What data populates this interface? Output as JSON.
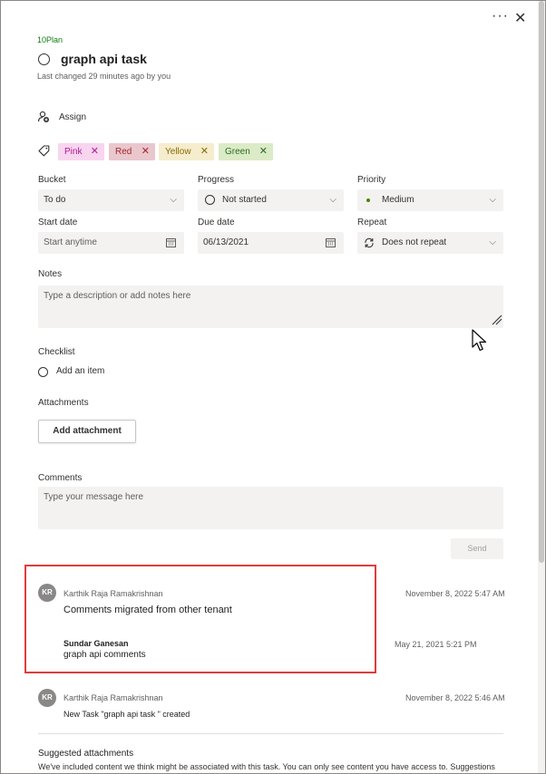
{
  "header": {
    "plan_name": "10Plan",
    "task_title": "graph api task",
    "last_changed": "Last changed 29 minutes ago by you",
    "more_icon": "more-horizontal-icon",
    "close_icon": "close-icon"
  },
  "assign": {
    "label": "Assign"
  },
  "labels": [
    {
      "name": "Pink",
      "bg": "#f8d5ef",
      "color": "#b4178e"
    },
    {
      "name": "Red",
      "bg": "#e9c7cd",
      "color": "#a4262c"
    },
    {
      "name": "Yellow",
      "bg": "#f5edce",
      "color": "#8a6a00"
    },
    {
      "name": "Green",
      "bg": "#dbebc7",
      "color": "#2c6b20"
    }
  ],
  "fields": {
    "bucket": {
      "label": "Bucket",
      "value": "To do"
    },
    "progress": {
      "label": "Progress",
      "value": "Not started"
    },
    "priority": {
      "label": "Priority",
      "value": "Medium",
      "dot_color": "#498205"
    },
    "start_date": {
      "label": "Start date",
      "placeholder": "Start anytime"
    },
    "due_date": {
      "label": "Due date",
      "value": "06/13/2021"
    },
    "repeat": {
      "label": "Repeat",
      "value": "Does not repeat"
    }
  },
  "notes": {
    "label": "Notes",
    "placeholder": "Type a description or add notes here"
  },
  "checklist": {
    "label": "Checklist",
    "add_item": "Add an item"
  },
  "attachments": {
    "label": "Attachments",
    "add_button": "Add attachment"
  },
  "comments": {
    "label": "Comments",
    "placeholder": "Type your message here",
    "send": "Send",
    "items": [
      {
        "initials": "KR",
        "author": "Karthik Raja Ramakrishnan",
        "time": "November 8, 2022 5:47 AM",
        "text": "Comments migrated from other tenant",
        "nested": {
          "author": "Sundar Ganesan",
          "text": "graph api comments",
          "time": "May 21, 2021 5:21 PM"
        }
      },
      {
        "initials": "KR",
        "author": "Karthik Raja Ramakrishnan",
        "time": "November 8, 2022 5:46 AM",
        "text": "New Task \"graph api task \" created"
      }
    ]
  },
  "suggested": {
    "title": "Suggested attachments",
    "text": "We've included content we think might be associated with this task. You can only see content you have access to. Suggestions"
  },
  "colors": {
    "highlight": "#e03c3c",
    "plan_green": "#107c10",
    "avatar": "#8a8886"
  }
}
